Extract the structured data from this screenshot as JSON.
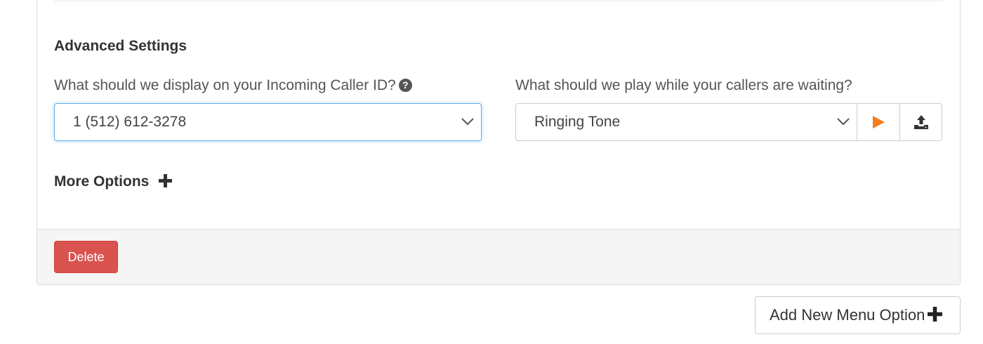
{
  "advanced": {
    "title": "Advanced Settings",
    "caller_id": {
      "label": "What should we display on your Incoming Caller ID?",
      "value": "1 (512) 612-3278"
    },
    "hold_music": {
      "label": "What should we play while your callers are waiting?",
      "value": "Ringing Tone"
    },
    "more_options_label": "More Options"
  },
  "footer": {
    "delete_label": "Delete"
  },
  "actions": {
    "add_menu_option_label": "Add New Menu Option"
  },
  "colors": {
    "danger": "#d9534f",
    "play_accent": "#f47c20",
    "focus_border": "#66afe9"
  },
  "icons": {
    "help": "question-circle-icon",
    "chevron": "chevron-down-icon",
    "play": "play-icon",
    "upload": "upload-icon",
    "plus": "plus-icon"
  }
}
